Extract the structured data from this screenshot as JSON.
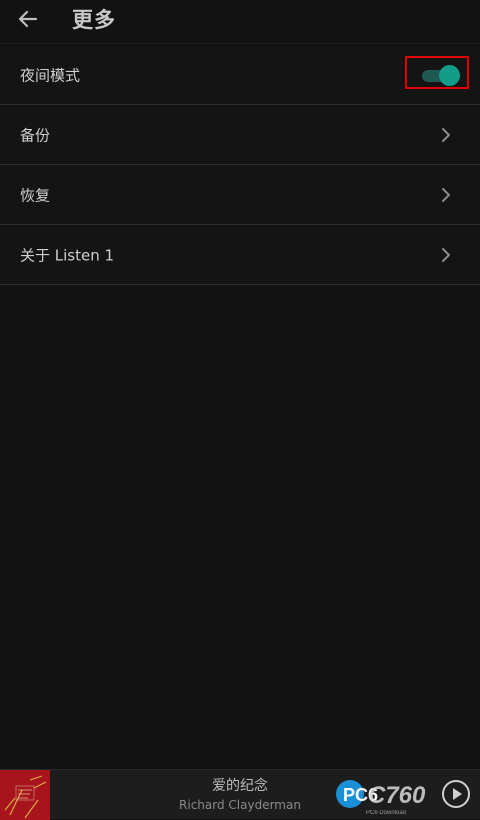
{
  "header": {
    "title": "更多",
    "back_icon": "arrow-left-icon"
  },
  "settings": {
    "items": [
      {
        "label": "夜间模式",
        "control": "toggle",
        "toggle_on": true
      },
      {
        "label": "备份",
        "control": "chevron"
      },
      {
        "label": "恢复",
        "control": "chevron"
      },
      {
        "label": "关于 Listen 1",
        "control": "chevron"
      }
    ]
  },
  "player": {
    "track_title": "爱的纪念",
    "artist": "Richard Clayderman",
    "watermark_text": "PC6",
    "watermark_subtitle": "PC6下载站"
  },
  "colors": {
    "background": "#121212",
    "toggle_accent": "#129c8a",
    "highlight_box": "#e00000"
  }
}
